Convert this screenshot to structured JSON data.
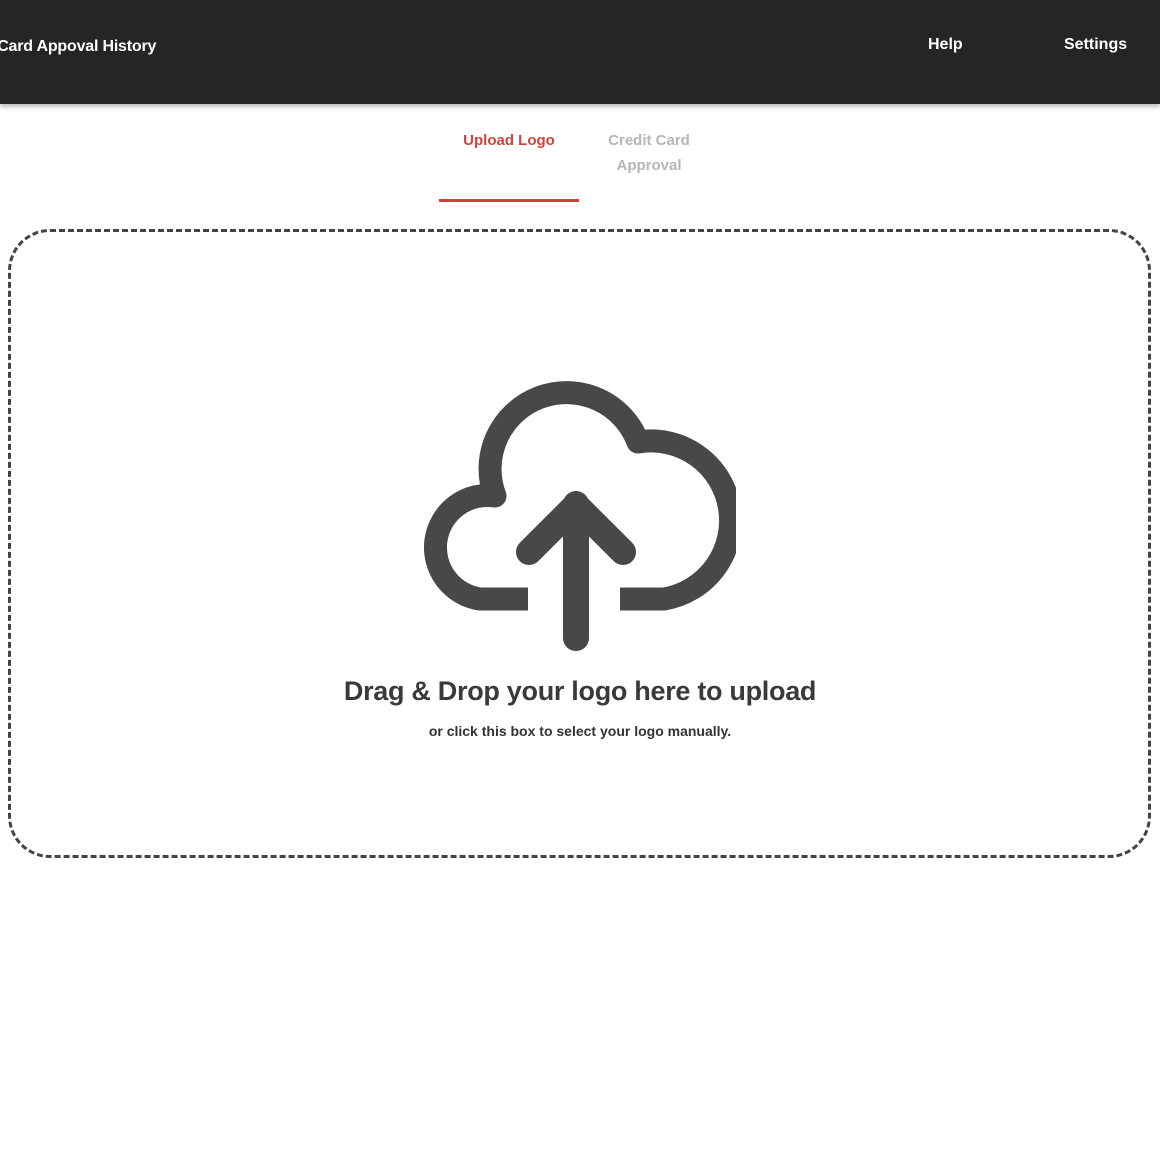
{
  "header": {
    "title": "dit Card Appoval History",
    "nav": {
      "help": "Help",
      "settings": "Settings"
    }
  },
  "tabs": {
    "upload_logo": "Upload Logo",
    "credit_card_approval_line1": "Credit Card",
    "credit_card_approval_line2": "Approval",
    "active": "Upload Logo"
  },
  "dropzone": {
    "icon": "cloud-upload-icon",
    "title": "Drag & Drop your logo here to upload",
    "subtitle": "or click this box to select your logo manually."
  },
  "colors": {
    "topbar": "#252525",
    "accent": "#d3403a",
    "inactive_tab": "#b5b5b5",
    "icon": "#484848"
  }
}
